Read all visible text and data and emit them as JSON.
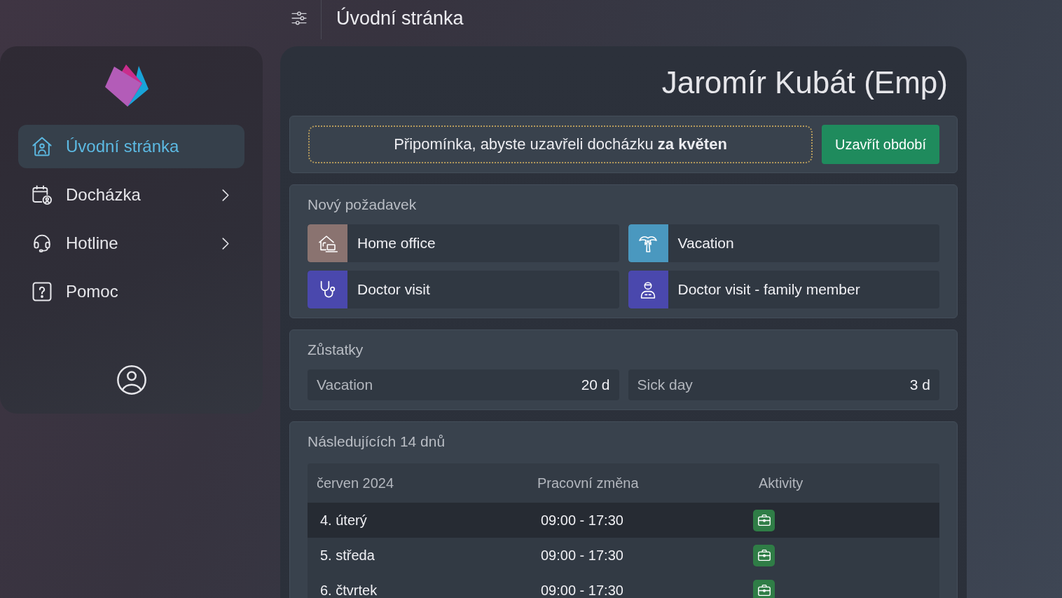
{
  "header": {
    "title": "Úvodní stránka"
  },
  "sidebar": {
    "items": [
      {
        "label": "Úvodní stránka",
        "kind": "home",
        "selected": true,
        "expandable": false
      },
      {
        "label": "Docházka",
        "kind": "calendar",
        "selected": false,
        "expandable": true
      },
      {
        "label": "Hotline",
        "kind": "headset",
        "selected": false,
        "expandable": true
      },
      {
        "label": "Pomoc",
        "kind": "help",
        "selected": false,
        "expandable": false
      }
    ]
  },
  "main": {
    "user_name": "Jaromír Kubát (Emp)"
  },
  "reminder": {
    "text": "Připomínka, abyste uzavřeli docházku **za květen**",
    "button": "Uzavřít období"
  },
  "new_request": {
    "title": "Nový požadavek",
    "items": [
      {
        "label": "Home office",
        "kind": "home-office",
        "color": "#8a7370"
      },
      {
        "label": "Vacation",
        "kind": "vacation",
        "color": "#4a98bf"
      },
      {
        "label": "Doctor visit",
        "kind": "doctor",
        "color": "#4a48ad"
      },
      {
        "label": "Doctor visit - family member",
        "kind": "family-doctor",
        "color": "#4a48ad"
      }
    ]
  },
  "balances": {
    "title": "Zůstatky",
    "items": [
      {
        "label": "Vacation",
        "value": "20 d"
      },
      {
        "label": "Sick day",
        "value": "3 d"
      }
    ]
  },
  "upcoming": {
    "title": "Následujících 14 dnů",
    "columns": [
      "červen 2024",
      "Pracovní změna",
      "Aktivity"
    ],
    "rows": [
      {
        "day": "4. úterý",
        "shift": "09:00 - 17:30",
        "kind": "work",
        "highlighted": true
      },
      {
        "day": "5. středa",
        "shift": "09:00 - 17:30",
        "kind": "work",
        "highlighted": false
      },
      {
        "day": "6. čtvrtek",
        "shift": "09:00 - 17:30",
        "kind": "work",
        "highlighted": false
      }
    ]
  }
}
